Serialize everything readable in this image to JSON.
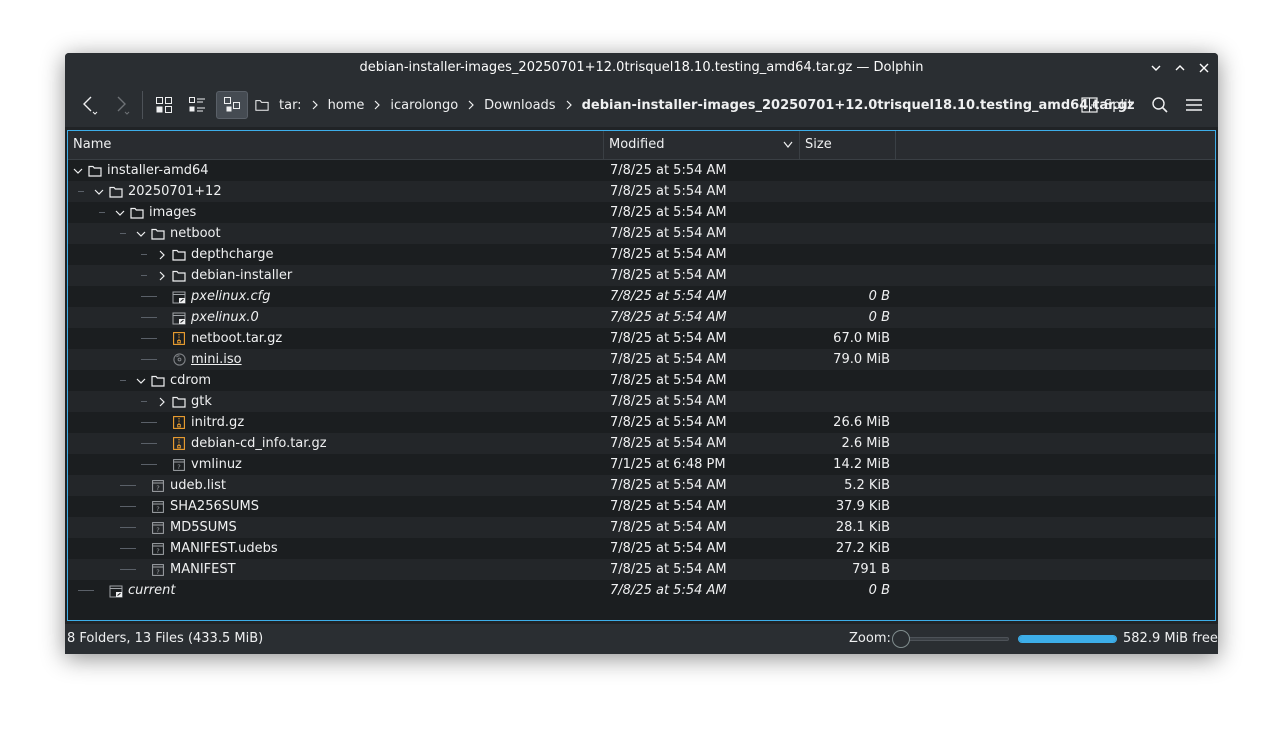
{
  "window": {
    "title": "debian-installer-images_20250701+12.0trisquel18.10.testing_amd64.tar.gz — Dolphin"
  },
  "toolbar": {
    "breadcrumbs": [
      "tar:",
      "home",
      "icarolongo",
      "Downloads",
      "debian-installer-images_20250701+12.0trisquel18.10.testing_amd64.tar.gz"
    ],
    "split_label": "Split"
  },
  "columns": {
    "name": "Name",
    "modified": "Modified",
    "size": "Size"
  },
  "files": [
    {
      "name": "installer-amd64",
      "modified": "7/8/25 at 5:54 AM",
      "size": "",
      "depth": 0,
      "type": "folder",
      "expanded": true
    },
    {
      "name": "20250701+12",
      "modified": "7/8/25 at 5:54 AM",
      "size": "",
      "depth": 1,
      "type": "folder",
      "expanded": true
    },
    {
      "name": "images",
      "modified": "7/8/25 at 5:54 AM",
      "size": "",
      "depth": 2,
      "type": "folder",
      "expanded": true
    },
    {
      "name": "netboot",
      "modified": "7/8/25 at 5:54 AM",
      "size": "",
      "depth": 3,
      "type": "folder",
      "expanded": true
    },
    {
      "name": "depthcharge",
      "modified": "7/8/25 at 5:54 AM",
      "size": "",
      "depth": 4,
      "type": "folder",
      "expanded": false
    },
    {
      "name": "debian-installer",
      "modified": "7/8/25 at 5:54 AM",
      "size": "",
      "depth": 4,
      "type": "folder",
      "expanded": false
    },
    {
      "name": "pxelinux.cfg",
      "modified": "7/8/25 at 5:54 AM",
      "size": "0 B",
      "depth": 4,
      "type": "symlink"
    },
    {
      "name": "pxelinux.0",
      "modified": "7/8/25 at 5:54 AM",
      "size": "0 B",
      "depth": 4,
      "type": "symlink"
    },
    {
      "name": "netboot.tar.gz",
      "modified": "7/8/25 at 5:54 AM",
      "size": "67.0 MiB",
      "depth": 4,
      "type": "archive"
    },
    {
      "name": "mini.iso",
      "modified": "7/8/25 at 5:54 AM",
      "size": "79.0 MiB",
      "depth": 4,
      "type": "iso"
    },
    {
      "name": "cdrom",
      "modified": "7/8/25 at 5:54 AM",
      "size": "",
      "depth": 3,
      "type": "folder",
      "expanded": true
    },
    {
      "name": "gtk",
      "modified": "7/8/25 at 5:54 AM",
      "size": "",
      "depth": 4,
      "type": "folder",
      "expanded": false
    },
    {
      "name": "initrd.gz",
      "modified": "7/8/25 at 5:54 AM",
      "size": "26.6 MiB",
      "depth": 4,
      "type": "archive"
    },
    {
      "name": "debian-cd_info.tar.gz",
      "modified": "7/8/25 at 5:54 AM",
      "size": "2.6 MiB",
      "depth": 4,
      "type": "archive"
    },
    {
      "name": "vmlinuz",
      "modified": "7/1/25 at 6:48 PM",
      "size": "14.2 MiB",
      "depth": 4,
      "type": "unknown"
    },
    {
      "name": "udeb.list",
      "modified": "7/8/25 at 5:54 AM",
      "size": "5.2 KiB",
      "depth": 3,
      "type": "unknown"
    },
    {
      "name": "SHA256SUMS",
      "modified": "7/8/25 at 5:54 AM",
      "size": "37.9 KiB",
      "depth": 3,
      "type": "unknown"
    },
    {
      "name": "MD5SUMS",
      "modified": "7/8/25 at 5:54 AM",
      "size": "28.1 KiB",
      "depth": 3,
      "type": "unknown"
    },
    {
      "name": "MANIFEST.udebs",
      "modified": "7/8/25 at 5:54 AM",
      "size": "27.2 KiB",
      "depth": 3,
      "type": "unknown"
    },
    {
      "name": "MANIFEST",
      "modified": "7/8/25 at 5:54 AM",
      "size": "791 B",
      "depth": 3,
      "type": "unknown"
    },
    {
      "name": "current",
      "modified": "7/8/25 at 5:54 AM",
      "size": "0 B",
      "depth": 1,
      "type": "symlink"
    }
  ],
  "status": {
    "summary": "8 Folders, 13 Files (433.5 MiB)",
    "zoom_label": "Zoom:",
    "free_space": "582.9 MiB free",
    "capacity_fraction": 1.0
  },
  "colors": {
    "accent": "#3daee9",
    "archive_icon": "#f0a030"
  }
}
